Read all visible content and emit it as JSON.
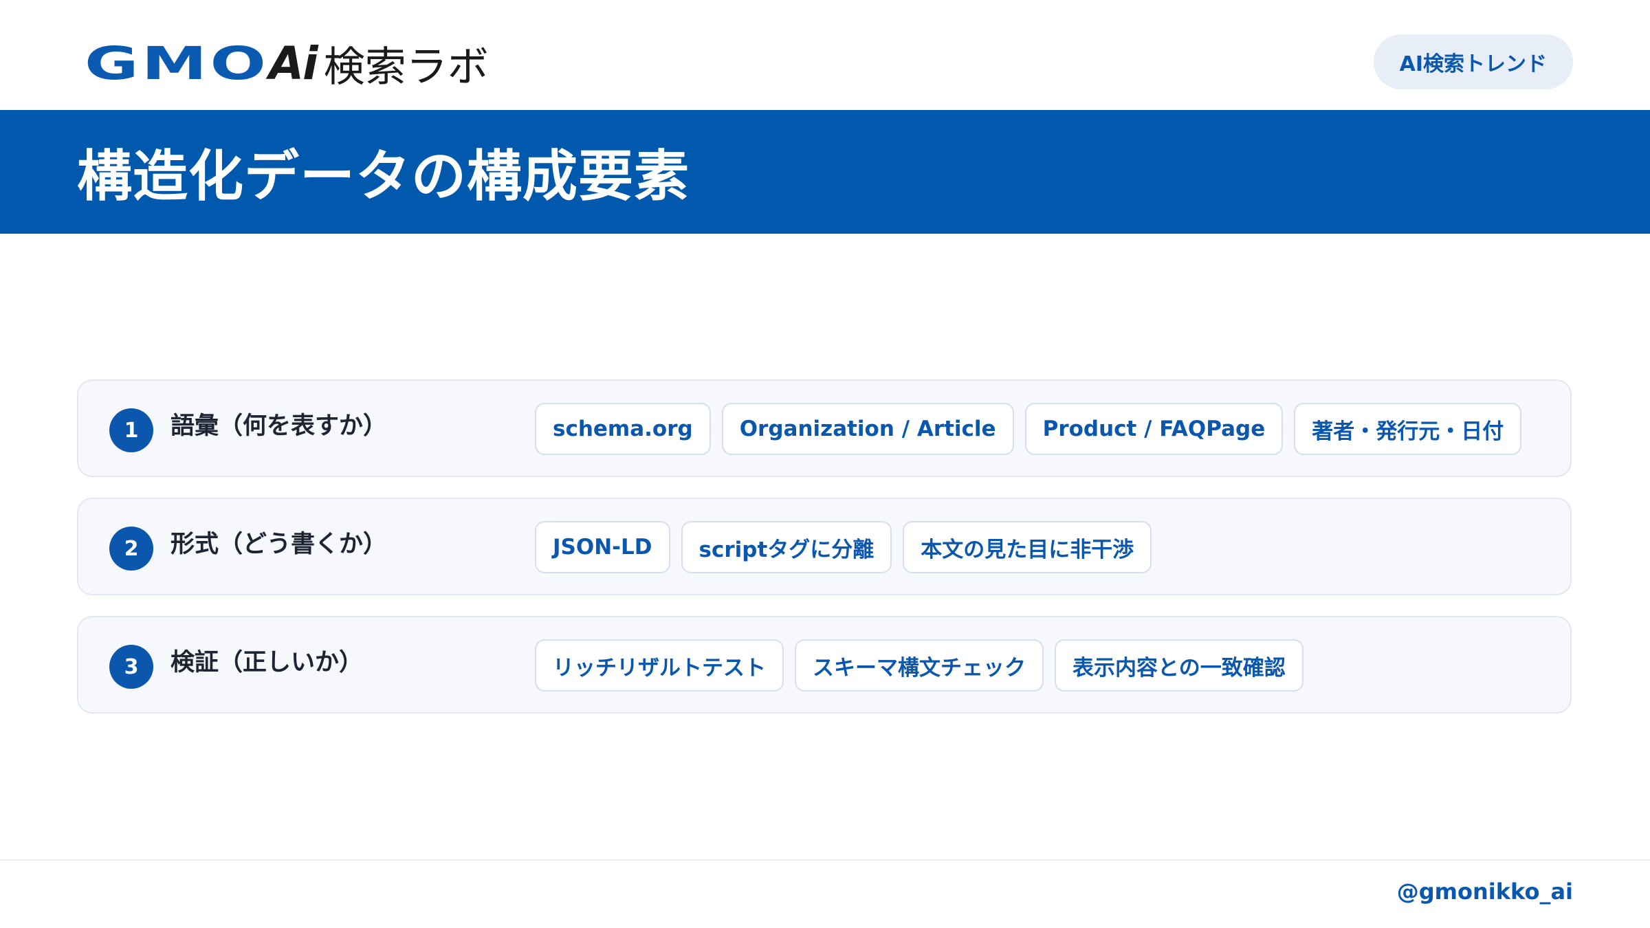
{
  "header": {
    "logo": {
      "gmo": "GMO",
      "ai": "Ai",
      "lab": "検索ラボ"
    },
    "badge_label": "AI検索トレンド"
  },
  "title": "構造化データの構成要素",
  "rows": [
    {
      "number": "1",
      "label": "語彙（何を表すか）",
      "chips": [
        "schema.org",
        "Organization / Article",
        "Product / FAQPage",
        "著者・発行元・日付"
      ]
    },
    {
      "number": "2",
      "label": "形式（どう書くか）",
      "chips": [
        "JSON-LD",
        "scriptタグに分離",
        "本文の見た目に非干渉"
      ]
    },
    {
      "number": "3",
      "label": "検証（正しいか）",
      "chips": [
        "リッチリザルトテスト",
        "スキーマ構文チェック",
        "表示内容との一致確認"
      ]
    }
  ],
  "footer": {
    "handle": "@gmonikko_ai"
  },
  "colors": {
    "brand_blue": "#0059ac",
    "accent_blue": "#0a57ad",
    "badge_bg": "#e7eef8",
    "row_bg": "#f6f8fc",
    "row_border": "#e2e8f1"
  }
}
